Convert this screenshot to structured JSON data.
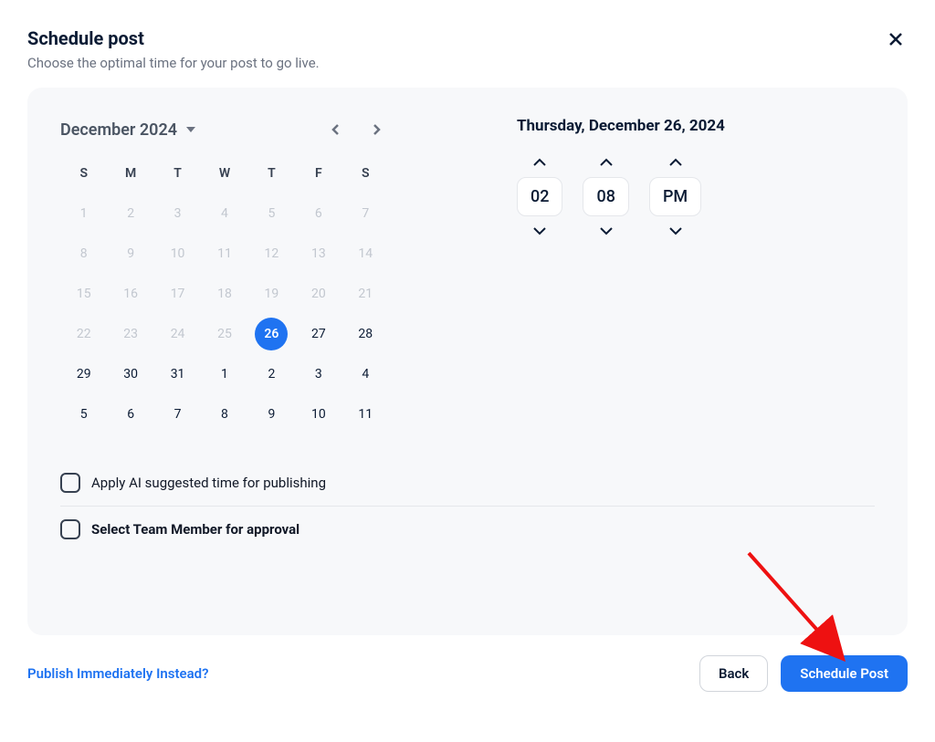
{
  "header": {
    "title": "Schedule post",
    "subtitle": "Choose the optimal time for your post to go live."
  },
  "calendar": {
    "month_label": "December 2024",
    "weekdays": [
      "S",
      "M",
      "T",
      "W",
      "T",
      "F",
      "S"
    ],
    "rows": [
      [
        {
          "n": "1",
          "muted": true
        },
        {
          "n": "2",
          "muted": true
        },
        {
          "n": "3",
          "muted": true
        },
        {
          "n": "4",
          "muted": true
        },
        {
          "n": "5",
          "muted": true
        },
        {
          "n": "6",
          "muted": true
        },
        {
          "n": "7",
          "muted": true
        }
      ],
      [
        {
          "n": "8",
          "muted": true
        },
        {
          "n": "9",
          "muted": true
        },
        {
          "n": "10",
          "muted": true
        },
        {
          "n": "11",
          "muted": true
        },
        {
          "n": "12",
          "muted": true
        },
        {
          "n": "13",
          "muted": true
        },
        {
          "n": "14",
          "muted": true
        }
      ],
      [
        {
          "n": "15",
          "muted": true
        },
        {
          "n": "16",
          "muted": true
        },
        {
          "n": "17",
          "muted": true
        },
        {
          "n": "18",
          "muted": true
        },
        {
          "n": "19",
          "muted": true
        },
        {
          "n": "20",
          "muted": true
        },
        {
          "n": "21",
          "muted": true
        }
      ],
      [
        {
          "n": "22",
          "muted": true
        },
        {
          "n": "23",
          "muted": true
        },
        {
          "n": "24",
          "muted": true
        },
        {
          "n": "25",
          "muted": true
        },
        {
          "n": "26",
          "muted": false,
          "selected": true
        },
        {
          "n": "27",
          "muted": false
        },
        {
          "n": "28",
          "muted": false
        }
      ],
      [
        {
          "n": "29",
          "muted": false
        },
        {
          "n": "30",
          "muted": false
        },
        {
          "n": "31",
          "muted": false
        },
        {
          "n": "1",
          "muted": false
        },
        {
          "n": "2",
          "muted": false
        },
        {
          "n": "3",
          "muted": false
        },
        {
          "n": "4",
          "muted": false
        }
      ],
      [
        {
          "n": "5",
          "muted": false
        },
        {
          "n": "6",
          "muted": false
        },
        {
          "n": "7",
          "muted": false
        },
        {
          "n": "8",
          "muted": false
        },
        {
          "n": "9",
          "muted": false
        },
        {
          "n": "10",
          "muted": false
        },
        {
          "n": "11",
          "muted": false
        }
      ]
    ]
  },
  "selected_date_label": "Thursday, December 26, 2024",
  "time": {
    "hour": "02",
    "minute": "08",
    "period": "PM"
  },
  "options": {
    "ai_time": "Apply AI suggested time for publishing",
    "team_member": "Select Team Member for approval"
  },
  "footer": {
    "publish_now": "Publish Immediately Instead?",
    "back": "Back",
    "schedule": "Schedule Post"
  }
}
